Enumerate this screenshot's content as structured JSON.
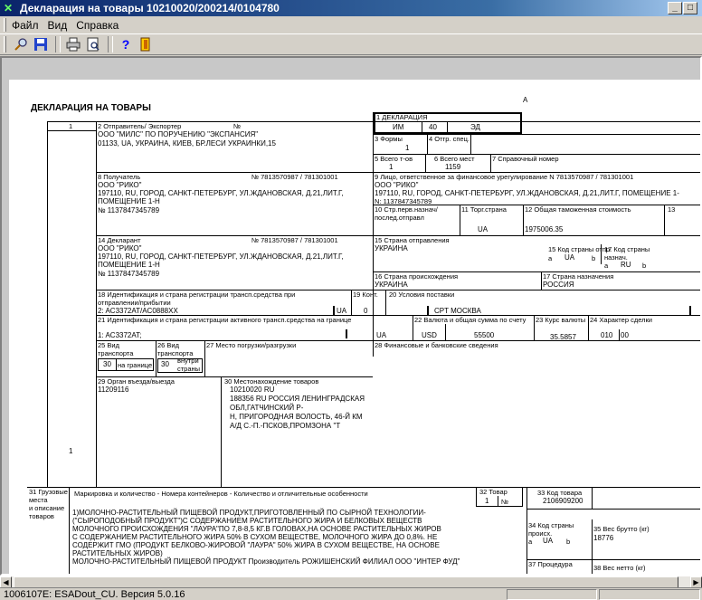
{
  "window": {
    "title": "Декларация на товары 10210020/200214/0104780",
    "min": "_",
    "restore": "□"
  },
  "menu": [
    "Файл",
    "Вид",
    "Справка"
  ],
  "toolbar_icons": [
    "search-icon",
    "save-icon",
    "print-icon",
    "preview-icon",
    "help-icon",
    "exit-icon"
  ],
  "status": {
    "text": "1006107E: ESADout_CU. Версия 5.0.16"
  },
  "doc": {
    "heading": "ДЕКЛАРАЦИЯ НА ТОВАРЫ",
    "corner_a": "А",
    "f1_label": "1",
    "box2_label": "2 Отправитель/ Экспортер",
    "box2_no": "№",
    "box2_name": "ООО \"МИЛС\" ПО ПОРУЧЕНИЮ \"ЭКСПАНСИЯ\"",
    "box2_addr": "01133, UA, УКРАИНА, КИЕВ, БР.ЛЕСИ УКРАИНКИ,15",
    "decl_label": "1 ДЕКЛАРАЦИЯ",
    "decl_im": "ИМ",
    "decl_40": "40",
    "decl_ed": "ЭД",
    "forms_label": "3 Формы",
    "forms_val": "1",
    "otgr_label": "4 Отгр. спец.",
    "total_goods_label": "5 Всего т-ов",
    "total_goods": "1",
    "total_places_label": "6 Всего мест",
    "total_places": "1159",
    "ref_label": "7 Справочный номер",
    "box8_label": "8 Получатель",
    "box8_no": "№ 7813570987 / 781301001",
    "box8_name": "ООО \"РИКО\"",
    "box8_addr1": "197110, RU, ГОРОД, САНКТ-ПЕТЕРБУРГ, УЛ.ЖДАНОВСКАЯ, Д.21,ЛИТ.Г,",
    "box8_addr2": "ПОМЕЩЕНИЕ 1-Н",
    "box8_ogrn": "№ 1137847345789",
    "box9_label": "9 Лицо, ответственное за финансовое урегулирование N 7813570987 / 781301001",
    "box9_name": "ООО \"РИКО\"",
    "box9_addr": "197110, RU, ГОРОД, САНКТ-ПЕТЕРБУРГ, УЛ.ЖДАНОВСКАЯ, Д.21,ЛИТ.Г, ПОМЕЩЕНИЕ 1-",
    "box9_ogrn": "N: 1137847345789",
    "box10_label1": "10 Стр.перв.назнач/",
    "box10_label2": "послед.отправл",
    "box11_label": "11 Торг.страна",
    "box11_val": "UA",
    "box12_label": "12 Общая таможенная стоимость",
    "box12_val": "1975006.35",
    "box13_label": "13",
    "box14_label": "14 Декларант",
    "box14_no": "№ 7813570987 / 781301001",
    "box14_name": "ООО \"РИКО\"",
    "box14_addr1": "197110, RU, ГОРОД, САНКТ-ПЕТЕРБУРГ, УЛ.ЖДАНОВСКАЯ, Д.21,ЛИТ.Г,",
    "box14_addr2": "ПОМЕЩЕНИЕ 1-Н",
    "box14_ogrn": "№ 1137847345789",
    "box15_label": "15 Страна отправления",
    "box15_val": "УКРАИНА",
    "box15a_label": "15 Код страны отпр.",
    "box15a_a": "a",
    "box15a_val": "UA",
    "box15a_b": "b",
    "box17a_label1": "17 Код страны",
    "box17a_label2": "назнач.",
    "box17a_a": "a",
    "box17a_val": "RU",
    "box17a_b": "b",
    "box16_label": "16 Страна происхождения",
    "box16_val": "УКРАИНА",
    "box17_label": "17 Страна назначения",
    "box17_val": "РОССИЯ",
    "box18_label1": "18 Идентификация и страна регистрации трансп.средства при",
    "box18_label2": "отправлении/прибытии",
    "box18_val": "2: AC3372AT/AC0888XX",
    "box18_country": "UA",
    "box19_label": "19 Конт.",
    "box19_val": "0",
    "box20_label": "20 Условия поставки",
    "box20_val": "CPT МОСКВА",
    "box21_label": "21 Идентификация и страна регистрации активного трансп.средства на границе",
    "box21_val": "1: AC3372AT;",
    "box21_country": "UA",
    "box22_label": "22 Валюта и общая сумма по счету",
    "box22_cur": "USD",
    "box22_sum": "55500",
    "box23_label": "23 Курс валюты",
    "box23_val": "35.5857",
    "box24_label": "24 Характер сделки",
    "box24_val1": "010",
    "box24_val2": "00",
    "box25_label1": "25 Вид",
    "box25_label2": "транспорта",
    "box25_label3": "на границе",
    "box25_val": "30",
    "box26_label1": "26 Вид",
    "box26_label2": "транспорта",
    "box26_label3": "внутри",
    "box26_label4": "страны",
    "box26_val": "30",
    "box27_label": "27 Место погрузки/разгрузки",
    "box28_label": "28 Финансовые и банковские сведения",
    "box29_label": "29 Орган въезда/выезда",
    "box29_val": "11209116",
    "box30_label": "30 Местонахождение товаров",
    "box30_l1": "10210020 RU",
    "box30_l2": "188356 RU РОССИЯ ЛЕНИНГРАДСКАЯ",
    "box30_l3": "ОБЛ,ГАТЧИНСКИЙ Р-",
    "box30_l4": "Н, ПРИГОРОДНАЯ ВОЛОСТЬ, 46-Й КМ",
    "box30_l5": "А/Д С.-П.-ПСКОВ,ПРОМЗОНА \"Т",
    "left_1": "1",
    "box31_label1": "31 Грузовые",
    "box31_label2": "места",
    "box31_label3": "и описание",
    "box31_label4": "товаров",
    "box31_head": "Маркировка и количество - Номера контейнеров - Количество и отличительные особенности",
    "box31_t1": "1)МОЛОЧНО-РАСТИТЕЛЬНЫЙ ПИЩЕВОЙ ПРОДУКТ,ПРИГОТОВЛЕННЫЙ ПО СЫРНОЙ ТЕХНОЛОГИИ-",
    "box31_t2": "(\"СЫРОПОДОБНЫЙ ПРОДУКТ\")С СОДЕРЖАНИЕМ РАСТИТЕЛЬНОГО ЖИРА И БЕЛКОВЫХ ВЕЩЕСТВ",
    "box31_t3": "МОЛОЧНОГО ПРОИСХОЖДЕНИЯ \"ЛАУРА\"ПО 7,8-8,5 КГ.В ГОЛОВАХ,НА ОСНОВЕ РАСТИТЕЛЬНЫХ ЖИРОВ",
    "box31_t4": "С СОДЕРЖАНИЕМ РАСТИТЕЛЬНОГО ЖИРА 50% В СУХОМ ВЕЩЕСТВЕ, МОЛОЧНОГО ЖИРА ДО 0,8%. НЕ",
    "box31_t5": "СОДЕРЖИТ ГМО (ПРОДУКТ БЕЛКОВО-ЖИРОВОЙ \"ЛАУРА\" 50% ЖИРА В СУХОМ ВЕЩЕСТВЕ, НА ОСНОВЕ",
    "box31_t6": "РАСТИТЕЛЬНЫХ ЖИРОВ)",
    "box31_t7": "МОЛОЧНО-РАСТИТЕЛЬНЫЙ ПИЩЕВОЙ ПРОДУКТ  Производитель РОЖИШЕНСКИЙ ФИЛИАЛ ООО \"ИНТЕР ФУД\"",
    "box32_label": "32 Товар",
    "box32_val": "1",
    "box32_no": "№",
    "box33_label": "33 Код товара",
    "box33_val": "2106909200",
    "box34_label1": "34 Код страны",
    "box34_label2": "происх.",
    "box34_a": "a",
    "box34_val": "UA",
    "box34_b": "b",
    "box35_label": "35 Вес брутто (кг)",
    "box35_val": "18776",
    "box37_label": "37 Процедура",
    "box38_label": "38 Вес нетто (кг)"
  }
}
